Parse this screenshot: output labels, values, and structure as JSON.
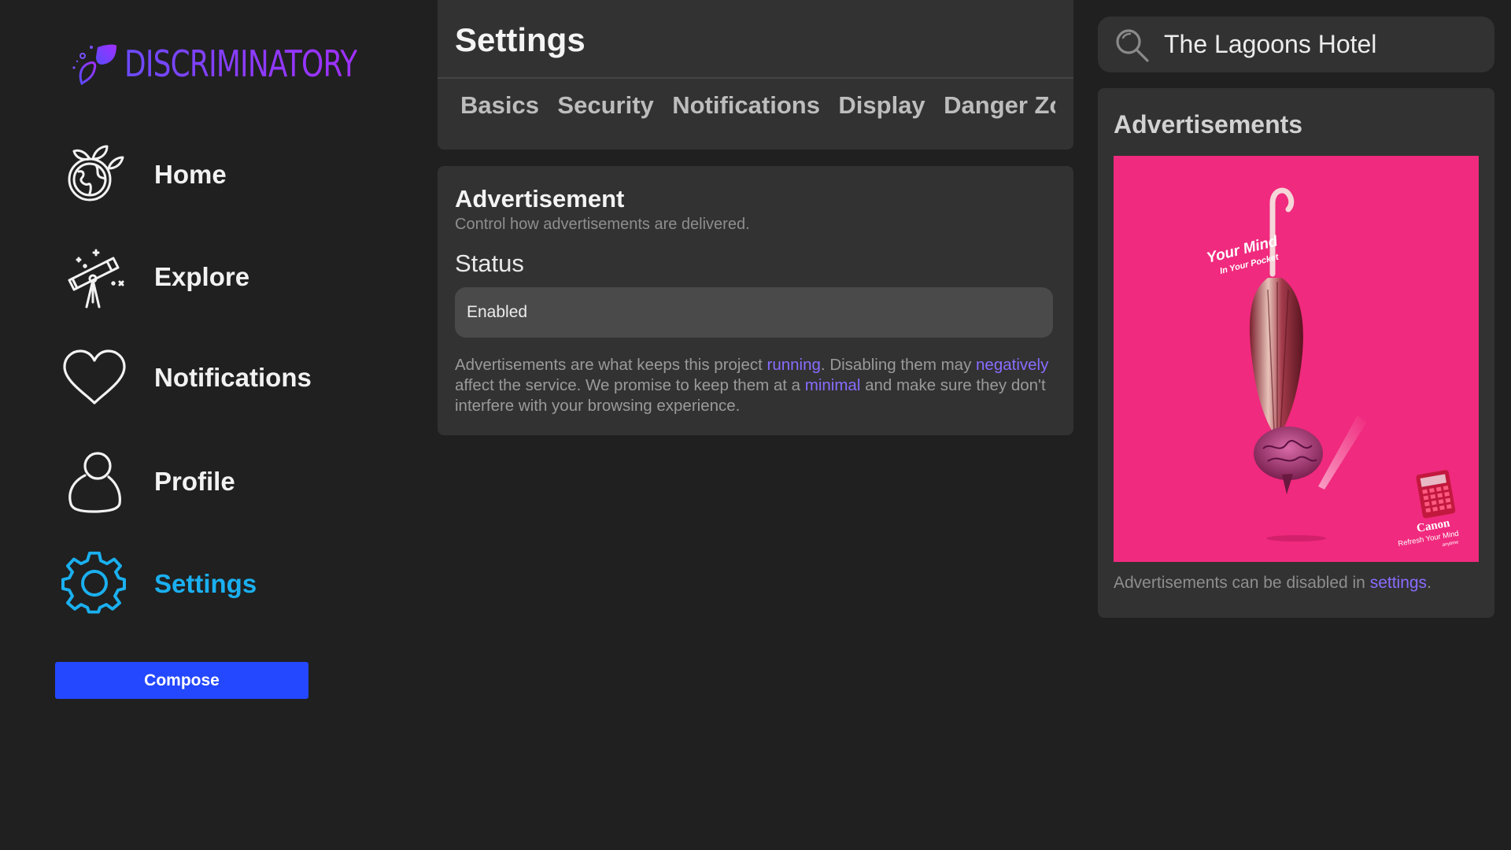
{
  "brand": {
    "name": "DISCRIMINATORY",
    "gradient_start": "#6c4bff",
    "gradient_end": "#a030ff"
  },
  "sidebar": {
    "items": [
      {
        "label": "Home",
        "icon": "globe-leaves-icon",
        "active": false
      },
      {
        "label": "Explore",
        "icon": "telescope-icon",
        "active": false
      },
      {
        "label": "Notifications",
        "icon": "heart-icon",
        "active": false
      },
      {
        "label": "Profile",
        "icon": "user-icon",
        "active": false
      },
      {
        "label": "Settings",
        "icon": "gear-icon",
        "active": true
      }
    ],
    "active_color": "#1ab0f0",
    "compose_label": "Compose",
    "compose_color": "#2448ff"
  },
  "settings": {
    "title": "Settings",
    "tabs": [
      "Basics",
      "Security",
      "Notifications",
      "Display",
      "Danger Zone"
    ]
  },
  "advertisement": {
    "title": "Advertisement",
    "subtitle": "Control how advertisements are delivered.",
    "status_label": "Status",
    "status_value": "Enabled",
    "desc_1": "Advertisements are what keeps this project ",
    "desc_link_1": "running",
    "desc_2": ". Disabling them may ",
    "desc_link_2": "negatively",
    "desc_3": " affect the service. We promise to keep them at a ",
    "desc_link_3": "minimal",
    "desc_4": " and make sure they don't interfere with your browsing experience.",
    "link_color": "#8a6cff"
  },
  "search": {
    "value": "The Lagoons Hotel",
    "icon": "search-icon"
  },
  "ads_panel": {
    "title": "Advertisements",
    "ad_headline_1": "Your Mind",
    "ad_headline_2": "In Your Pocket",
    "ad_brand": "Canon",
    "ad_tagline_1": "Refresh Your Mind",
    "ad_tagline_2": "anytime",
    "ad_background": "#f02a7e",
    "footer_text": "Advertisements can be disabled in ",
    "footer_link": "settings",
    "footer_end": "."
  }
}
